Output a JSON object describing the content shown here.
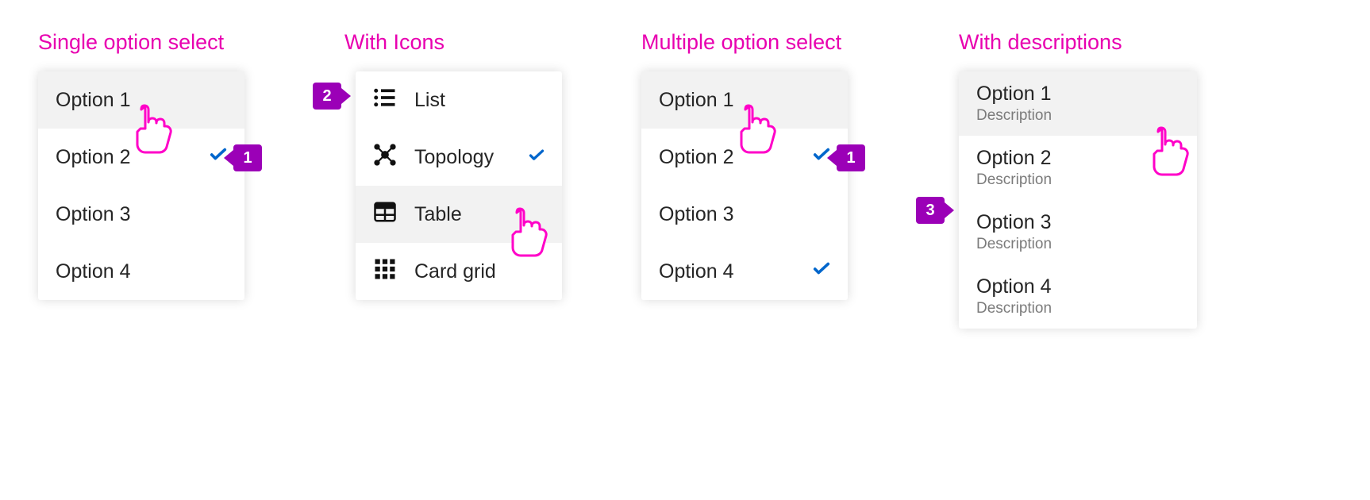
{
  "colors": {
    "accent_pink": "#e800b0",
    "check_blue": "#0066cc",
    "anno_purple": "#9b00b7"
  },
  "panel1": {
    "title": "Single option select",
    "items": [
      {
        "label": "Option 1"
      },
      {
        "label": "Option 2",
        "selected": true
      },
      {
        "label": "Option 3"
      },
      {
        "label": "Option 4"
      }
    ],
    "annotation": "1"
  },
  "panel2": {
    "title": "With Icons",
    "items": [
      {
        "label": "List",
        "icon": "list-icon"
      },
      {
        "label": "Topology",
        "icon": "topology-icon",
        "selected": true
      },
      {
        "label": "Table",
        "icon": "table-icon"
      },
      {
        "label": "Card grid",
        "icon": "grid-icon"
      }
    ],
    "annotation": "2"
  },
  "panel3": {
    "title": "Multiple option select",
    "items": [
      {
        "label": "Option 1"
      },
      {
        "label": "Option 2",
        "selected": true
      },
      {
        "label": "Option 3"
      },
      {
        "label": "Option 4",
        "selected": true
      }
    ],
    "annotation": "1"
  },
  "panel4": {
    "title": "With descriptions",
    "items": [
      {
        "label": "Option 1",
        "desc": "Description"
      },
      {
        "label": "Option 2",
        "desc": "Description",
        "selected": true
      },
      {
        "label": "Option 3",
        "desc": "Description"
      },
      {
        "label": "Option 4",
        "desc": "Description"
      }
    ],
    "annotation": "3"
  }
}
